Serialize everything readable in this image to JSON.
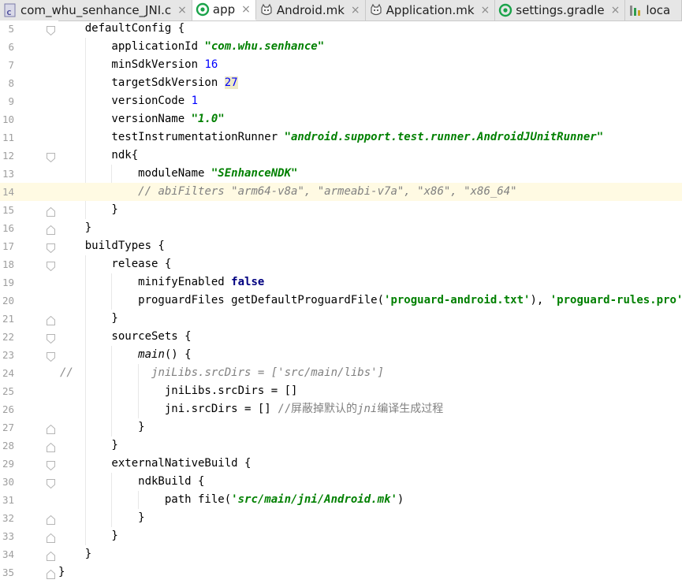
{
  "tabs": [
    {
      "label": "com_whu_senhance_JNI.c",
      "icon": "c-file-icon",
      "active": false
    },
    {
      "label": "app",
      "icon": "gradle-app-icon",
      "active": true
    },
    {
      "label": "Android.mk",
      "icon": "makefile-icon",
      "active": false
    },
    {
      "label": "Application.mk",
      "icon": "makefile-icon",
      "active": false
    },
    {
      "label": "settings.gradle",
      "icon": "gradle-app-icon",
      "active": false
    },
    {
      "label": "loca",
      "icon": "properties-file-icon",
      "active": false
    }
  ],
  "close_glyph": "×",
  "editor": {
    "current_line": 14,
    "lines": [
      {
        "n": "5",
        "fold": "open",
        "segs": [
          [
            "",
            "    defaultConfig {"
          ]
        ]
      },
      {
        "n": "6",
        "fold": "",
        "segs": [
          [
            "",
            "        applicationId "
          ],
          [
            "str",
            "\"com.whu.senhance\""
          ]
        ]
      },
      {
        "n": "7",
        "fold": "",
        "segs": [
          [
            "",
            "        minSdkVersion "
          ],
          [
            "num-lit",
            "16"
          ]
        ]
      },
      {
        "n": "8",
        "fold": "",
        "segs": [
          [
            "",
            "        targetSdkVersion "
          ],
          [
            "num-lit hl",
            "27"
          ]
        ]
      },
      {
        "n": "9",
        "fold": "",
        "segs": [
          [
            "",
            "        versionCode "
          ],
          [
            "num-lit",
            "1"
          ]
        ]
      },
      {
        "n": "10",
        "fold": "",
        "segs": [
          [
            "",
            "        versionName "
          ],
          [
            "str",
            "\"1.0\""
          ]
        ]
      },
      {
        "n": "11",
        "fold": "",
        "segs": [
          [
            "",
            "        testInstrumentationRunner "
          ],
          [
            "str",
            "\"android.support.test.runner.AndroidJUnitRunner\""
          ]
        ]
      },
      {
        "n": "12",
        "fold": "open",
        "segs": [
          [
            "",
            "        ndk{"
          ]
        ]
      },
      {
        "n": "13",
        "fold": "",
        "segs": [
          [
            "",
            "            moduleName "
          ],
          [
            "str",
            "\"SEnhanceNDK\""
          ]
        ]
      },
      {
        "n": "14",
        "fold": "",
        "segs": [
          [
            "",
            "            "
          ],
          [
            "cmt",
            "// abiFilters \"arm64-v8a\", \"armeabi-v7a\", \"x86\", \"x86_64\""
          ]
        ]
      },
      {
        "n": "15",
        "fold": "close",
        "segs": [
          [
            "",
            "        }"
          ]
        ]
      },
      {
        "n": "16",
        "fold": "close",
        "segs": [
          [
            "",
            "    }"
          ]
        ]
      },
      {
        "n": "17",
        "fold": "open",
        "segs": [
          [
            "",
            "    buildTypes {"
          ]
        ]
      },
      {
        "n": "18",
        "fold": "open",
        "segs": [
          [
            "",
            "        release {"
          ]
        ]
      },
      {
        "n": "19",
        "fold": "",
        "segs": [
          [
            "",
            "            minifyEnabled "
          ],
          [
            "kw",
            "false"
          ]
        ]
      },
      {
        "n": "20",
        "fold": "",
        "segs": [
          [
            "",
            "            proguardFiles getDefaultProguardFile("
          ],
          [
            "str2",
            "'proguard-android.txt'"
          ],
          [
            "",
            "), "
          ],
          [
            "str2",
            "'proguard-rules.pro'"
          ]
        ]
      },
      {
        "n": "21",
        "fold": "close",
        "segs": [
          [
            "",
            "        }"
          ]
        ]
      },
      {
        "n": "22",
        "fold": "open",
        "segs": [
          [
            "",
            "        sourceSets {"
          ]
        ]
      },
      {
        "n": "23",
        "fold": "open",
        "segs": [
          [
            "",
            "            "
          ],
          [
            "fn",
            "main"
          ],
          [
            "",
            "() {"
          ]
        ]
      },
      {
        "n": "24",
        "fold": "",
        "prefix": "//",
        "segs": [
          [
            "",
            "              "
          ],
          [
            "cmt",
            "jniLibs.srcDirs = ['src/main/libs']"
          ]
        ]
      },
      {
        "n": "25",
        "fold": "",
        "segs": [
          [
            "",
            "                jniLibs.srcDirs = []"
          ]
        ]
      },
      {
        "n": "26",
        "fold": "",
        "segs": [
          [
            "",
            "                jni.srcDirs = [] "
          ],
          [
            "cmt-cn",
            "//屏蔽掉默认的"
          ],
          [
            "cmt-kw",
            "jni"
          ],
          [
            "cmt-cn",
            "编译生成过程"
          ]
        ]
      },
      {
        "n": "27",
        "fold": "close",
        "segs": [
          [
            "",
            "            }"
          ]
        ]
      },
      {
        "n": "28",
        "fold": "close",
        "segs": [
          [
            "",
            "        }"
          ]
        ]
      },
      {
        "n": "29",
        "fold": "open",
        "segs": [
          [
            "",
            "        externalNativeBuild {"
          ]
        ]
      },
      {
        "n": "30",
        "fold": "open",
        "segs": [
          [
            "",
            "            ndkBuild {"
          ]
        ]
      },
      {
        "n": "31",
        "fold": "",
        "segs": [
          [
            "",
            "                path file("
          ],
          [
            "str",
            "'src/main/jni/Android.mk'"
          ],
          [
            "",
            ")"
          ]
        ]
      },
      {
        "n": "32",
        "fold": "close",
        "segs": [
          [
            "",
            "            }"
          ]
        ]
      },
      {
        "n": "33",
        "fold": "close",
        "segs": [
          [
            "",
            "        }"
          ]
        ]
      },
      {
        "n": "34",
        "fold": "close",
        "segs": [
          [
            "",
            "    }"
          ]
        ]
      },
      {
        "n": "35",
        "fold": "close",
        "segs": [
          [
            "",
            "}"
          ]
        ]
      }
    ]
  }
}
